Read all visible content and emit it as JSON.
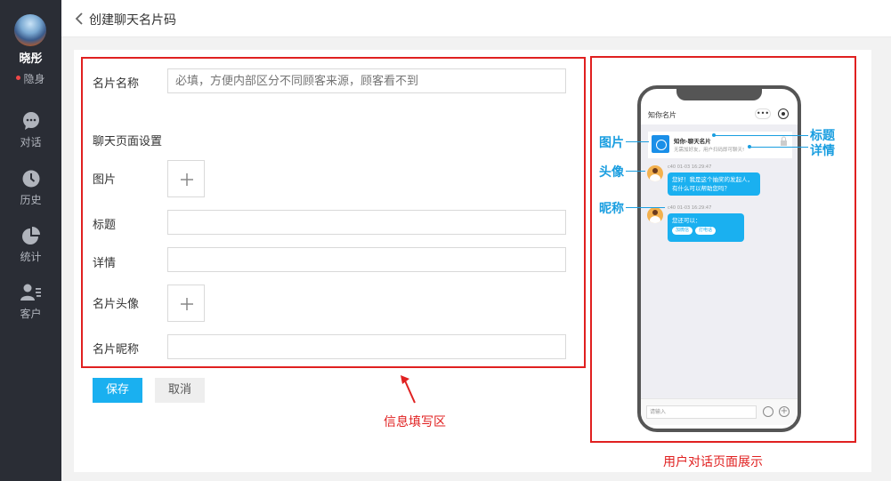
{
  "sidebar": {
    "user_name": "晓彤",
    "user_status": "隐身",
    "nav": [
      {
        "label": "对话",
        "icon": "chat-icon"
      },
      {
        "label": "历史",
        "icon": "clock-icon"
      },
      {
        "label": "统计",
        "icon": "pie-chart-icon"
      },
      {
        "label": "客户",
        "icon": "customer-icon"
      }
    ]
  },
  "header": {
    "title": "创建聊天名片码"
  },
  "form": {
    "card_name_label": "名片名称",
    "card_name_placeholder": "必填，方便内部区分不同顾客来源，顾客看不到",
    "section_title": "聊天页面设置",
    "image_label": "图片",
    "title_label": "标题",
    "detail_label": "详情",
    "avatar_label": "名片头像",
    "nickname_label": "名片昵称",
    "title_value": "",
    "detail_value": "",
    "nickname_value": ""
  },
  "buttons": {
    "save": "保存",
    "cancel": "取消"
  },
  "annotations": {
    "form_area": "信息填写区",
    "preview_area": "用户对话页面展示"
  },
  "preview": {
    "app_title": "知你名片",
    "more_label": "•••",
    "card_title": "知你-聊天名片",
    "card_detail": "无需加好友，用户扫码即可聊天!",
    "card_lock_label": "锁定",
    "msg1_meta": "c40  01-03 16:29:47",
    "msg1_text": "您好！我是这个抽奖的发起人，有什么可以帮助您吗？",
    "msg2_meta": "c40  01-03 16:29:47",
    "msg2_text": "您还可以：",
    "msg2_btn1": "加微信",
    "msg2_btn2": "打电话",
    "input_placeholder": "请输入"
  },
  "callouts": {
    "image": "图片",
    "avatar": "头像",
    "nickname": "昵称",
    "title": "标题",
    "detail": "详情"
  },
  "colors": {
    "accent": "#1ab0f0",
    "annotation_red": "#e02020",
    "callout_blue": "#1a9ee0",
    "sidebar_bg": "#2a2d35"
  }
}
